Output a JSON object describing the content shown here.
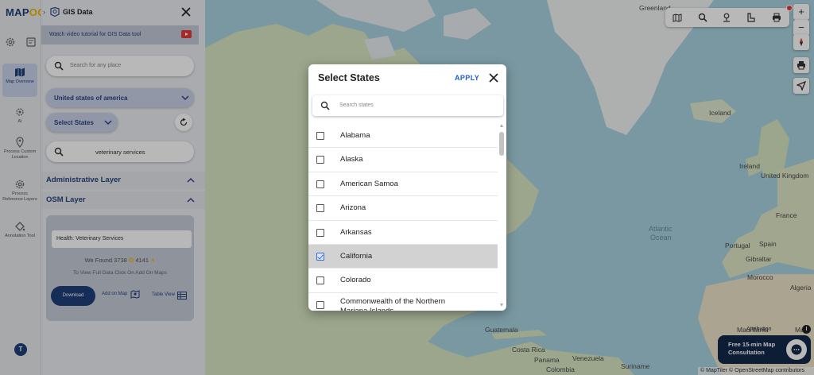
{
  "app": {
    "logo_prefix": "MAP",
    "logo_suffix": "OG"
  },
  "rail": {
    "items": [
      {
        "label": "Map Overview",
        "icon": "map-icon",
        "active": true
      },
      {
        "label": "AI",
        "icon": "ai-icon"
      },
      {
        "label": "Process Custom Location",
        "icon": "location-pin-icon"
      },
      {
        "label": "Process Reference Layers",
        "icon": "gear-icon"
      },
      {
        "label": "Annotation Tool",
        "icon": "paint-bucket-icon"
      }
    ],
    "avatar": "T"
  },
  "panel": {
    "title": "GIS Data",
    "tutorial": "Watch video tutorial for GIS Data tool",
    "search_placeholder": "Search for any place",
    "country": "United states of america",
    "select_states": "Select States",
    "search_value": "veterinary services",
    "administrative_layer": "Administrative Layer",
    "osm_layer": "OSM Layer",
    "result": {
      "field": "Health: Veterinary Services",
      "found_prefix": "We Found",
      "count_a": "3738",
      "count_b": "4141",
      "view_full": "To View Full Data Click On Add On Maps",
      "download": "Download",
      "add_on_map": "Add on Map",
      "table_view": "Table View"
    }
  },
  "map": {
    "labels": {
      "greenland": "Greenland",
      "iceland": "Iceland",
      "ireland": "Ireland",
      "united_kingdom": "United Kingdom",
      "atlantic_ocean_1": "Atlantic",
      "atlantic_ocean_2": "Ocean",
      "france": "France",
      "spain": "Spain",
      "portugal": "Portugal",
      "gibraltar": "Gibraltar",
      "morocco": "Morocco",
      "algeria": "Algeria",
      "mauritania": "Mauritania",
      "mali": "Mali",
      "guatemala": "Guatemala",
      "costa_rica": "Costa Rica",
      "panama": "Panama",
      "venezuela": "Venezuela",
      "colombia": "Colombia",
      "suriname": "Suriname"
    },
    "attribution": "Attribution",
    "copyright": "© MapTiler © OpenStreetMap contributors",
    "consult": {
      "line1": "Free 15-min Map",
      "line2": "Consultation"
    },
    "zoom_in": "+",
    "zoom_out": "−"
  },
  "dialog": {
    "title": "Select States",
    "apply": "APPLY",
    "search_placeholder": "Search states",
    "states": [
      {
        "name": "Alabama",
        "checked": false
      },
      {
        "name": "Alaska",
        "checked": false
      },
      {
        "name": "American Samoa",
        "checked": false
      },
      {
        "name": "Arizona",
        "checked": false
      },
      {
        "name": "Arkansas",
        "checked": false
      },
      {
        "name": "California",
        "checked": true
      },
      {
        "name": "Colorado",
        "checked": false
      },
      {
        "name": "Commonwealth of the Northern Mariana Islands",
        "checked": false
      }
    ]
  },
  "colors": {
    "brand_navy": "#1f3f7a",
    "brand_yellow": "#f2b400",
    "apply_blue": "#1f5fd1",
    "ocean": "#a9d3df",
    "land": "#d6e3c0"
  }
}
